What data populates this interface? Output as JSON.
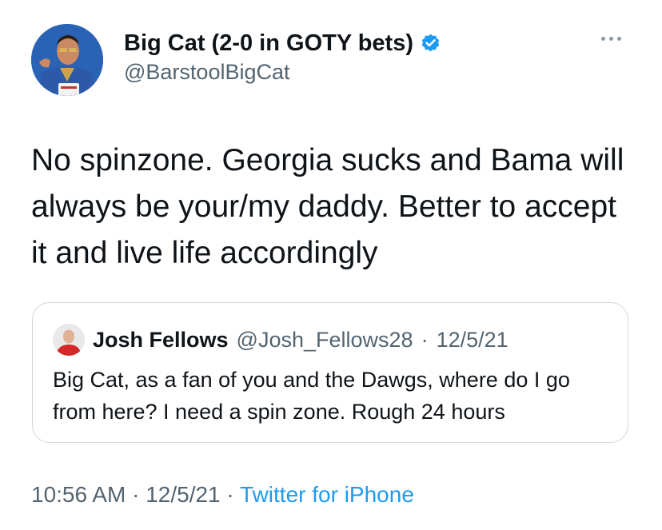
{
  "author": {
    "display_name": "Big Cat (2-0 in GOTY bets)",
    "handle": "@BarstoolBigCat",
    "verified_color": "#1d9bf0"
  },
  "tweet": {
    "text": "No spinzone. Georgia sucks and Bama will always be your/my daddy. Better to accept it and live life accordingly"
  },
  "quote": {
    "display_name": "Josh Fellows",
    "handle": "@Josh_Fellows28",
    "separator": "·",
    "date": "12/5/21",
    "text": "Big Cat, as a fan of you and the Dawgs, where do I go from here? I need a spin zone. Rough 24 hours"
  },
  "footer": {
    "time": "10:56 AM",
    "sep1": " · ",
    "date": "12/5/21",
    "sep2": " · ",
    "source": "Twitter for iPhone"
  },
  "colors": {
    "text": "#0f1419",
    "muted": "#536471",
    "link": "#1d9bf0",
    "border": "#cfd9de"
  }
}
